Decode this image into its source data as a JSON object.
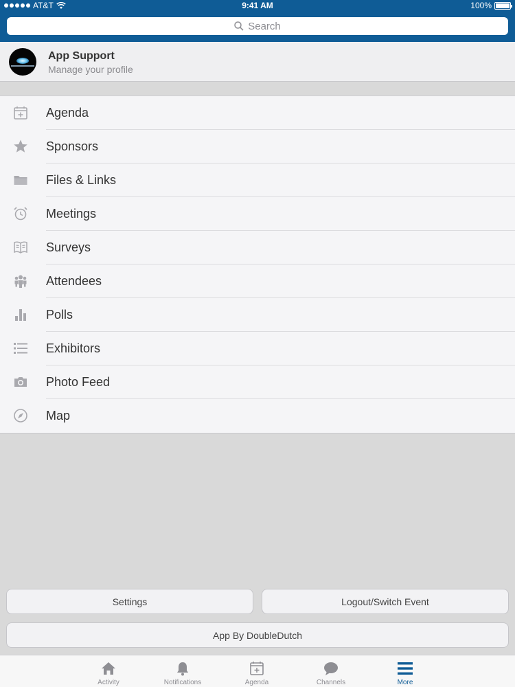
{
  "status_bar": {
    "carrier": "AT&T",
    "time": "9:41 AM",
    "battery": "100%"
  },
  "search": {
    "placeholder": "Search"
  },
  "profile": {
    "name": "App Support",
    "subtitle": "Manage your profile"
  },
  "menu": {
    "items": [
      {
        "label": "Agenda",
        "icon": "calendar-icon"
      },
      {
        "label": "Sponsors",
        "icon": "star-icon"
      },
      {
        "label": "Files & Links",
        "icon": "folder-icon"
      },
      {
        "label": "Meetings",
        "icon": "alarm-clock-icon"
      },
      {
        "label": "Surveys",
        "icon": "book-icon"
      },
      {
        "label": "Attendees",
        "icon": "people-icon"
      },
      {
        "label": "Polls",
        "icon": "bar-chart-icon"
      },
      {
        "label": "Exhibitors",
        "icon": "list-icon"
      },
      {
        "label": "Photo Feed",
        "icon": "camera-icon"
      },
      {
        "label": "Map",
        "icon": "compass-icon"
      }
    ]
  },
  "buttons": {
    "settings": "Settings",
    "logout": "Logout/Switch Event",
    "app_by": "App By DoubleDutch"
  },
  "tabbar": {
    "tabs": [
      {
        "label": "Activity",
        "icon": "home-icon",
        "active": false
      },
      {
        "label": "Notifications",
        "icon": "bell-icon",
        "active": false
      },
      {
        "label": "Agenda",
        "icon": "calendar-icon",
        "active": false
      },
      {
        "label": "Channels",
        "icon": "chat-bubble-icon",
        "active": false
      },
      {
        "label": "More",
        "icon": "menu-icon",
        "active": true
      }
    ]
  },
  "colors": {
    "brand": "#0f5c96",
    "icon_gray": "#a9a9ae",
    "background": "#d9d9d9"
  }
}
